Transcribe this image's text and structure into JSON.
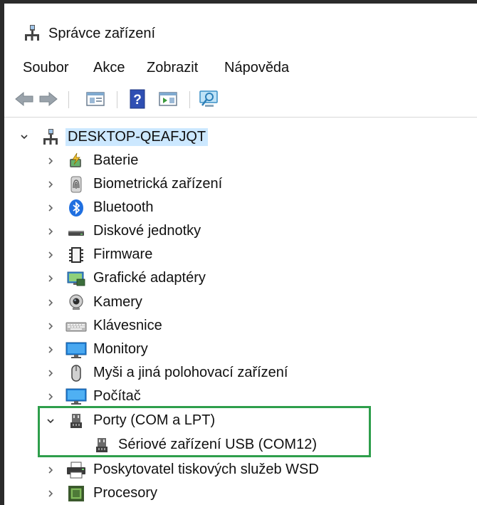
{
  "window": {
    "title": "Správce zařízení",
    "icon": "device-manager-icon"
  },
  "menu": {
    "items": [
      "Soubor",
      "Akce",
      "Zobrazit",
      "Nápověda"
    ]
  },
  "toolbar": {
    "buttons": [
      "back-icon",
      "forward-icon",
      "properties-icon",
      "help-icon",
      "update-driver-icon",
      "scan-hardware-icon"
    ]
  },
  "tree": {
    "root": {
      "label": "DESKTOP-QEAFJQT",
      "expanded": true,
      "icon": "computer-network-icon"
    },
    "nodes": [
      {
        "label": "Baterie",
        "icon": "battery-icon",
        "expanded": false
      },
      {
        "label": "Biometrická zařízení",
        "icon": "fingerprint-icon",
        "expanded": false
      },
      {
        "label": "Bluetooth",
        "icon": "bluetooth-icon",
        "expanded": false
      },
      {
        "label": "Diskové jednotky",
        "icon": "disk-drive-icon",
        "expanded": false
      },
      {
        "label": "Firmware",
        "icon": "firmware-chip-icon",
        "expanded": false
      },
      {
        "label": "Grafické adaptéry",
        "icon": "display-adapter-icon",
        "expanded": false
      },
      {
        "label": "Kamery",
        "icon": "camera-icon",
        "expanded": false
      },
      {
        "label": "Klávesnice",
        "icon": "keyboard-icon",
        "expanded": false
      },
      {
        "label": "Monitory",
        "icon": "monitor-icon",
        "expanded": false
      },
      {
        "label": "Myši a jiná polohovací zařízení",
        "icon": "mouse-icon",
        "expanded": false
      },
      {
        "label": "Počítač",
        "icon": "computer-icon",
        "expanded": false
      },
      {
        "label": "Porty (COM a LPT)",
        "icon": "port-icon",
        "expanded": true,
        "children": [
          {
            "label": "Sériové zařízení USB (COM12)",
            "icon": "usb-serial-device-icon"
          }
        ]
      },
      {
        "label": "Poskytovatel tiskových služeb WSD",
        "icon": "printer-icon",
        "expanded": false
      },
      {
        "label": "Procesory",
        "icon": "processor-icon",
        "expanded": false
      }
    ]
  },
  "colors": {
    "selection": "#cce8ff",
    "highlight_box": "#2e9e4b"
  }
}
